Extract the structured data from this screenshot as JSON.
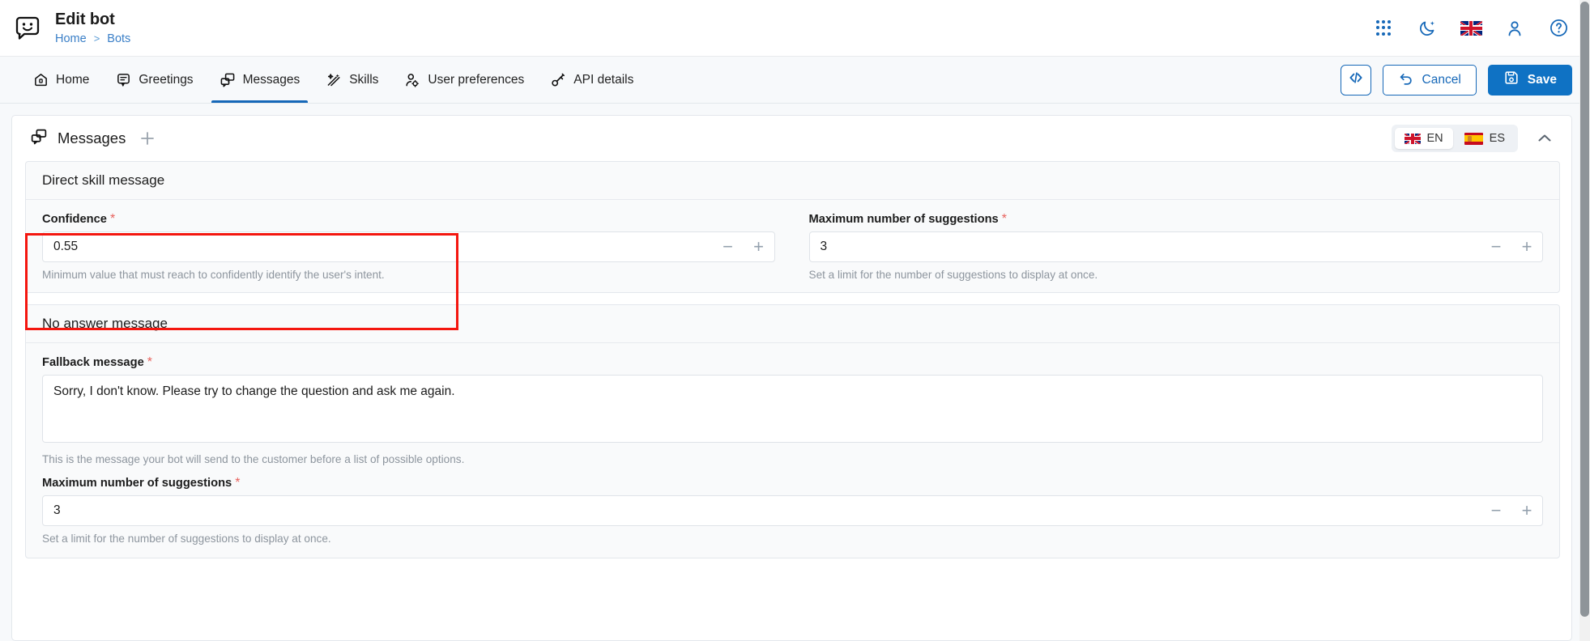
{
  "header": {
    "logo_icon": "chat-bot-smiley-icon",
    "title": "Edit bot",
    "breadcrumb": {
      "home": "Home",
      "separator": ">",
      "current": "Bots"
    },
    "icons": [
      {
        "name": "apps-grid-icon",
        "label": "Apps"
      },
      {
        "name": "dark-mode-moon-icon",
        "label": "Dark mode"
      },
      {
        "name": "language-flag-uk-icon",
        "label": "EN"
      },
      {
        "name": "user-account-icon",
        "label": "Account"
      },
      {
        "name": "help-question-icon",
        "label": "Help"
      }
    ]
  },
  "nav": {
    "tabs": [
      {
        "label": "Home",
        "icon": "home-icon",
        "active": false
      },
      {
        "label": "Greetings",
        "icon": "chat-bubble-icon",
        "active": false
      },
      {
        "label": "Messages",
        "icon": "messages-icon",
        "active": true
      },
      {
        "label": "Skills",
        "icon": "magic-wand-icon",
        "active": false
      },
      {
        "label": "User preferences",
        "icon": "user-settings-icon",
        "active": false
      },
      {
        "label": "API details",
        "icon": "api-key-icon",
        "active": false
      }
    ],
    "actions": {
      "code_button": {
        "label": "",
        "icon": "code-brackets-icon"
      },
      "cancel": {
        "label": "Cancel",
        "icon": "undo-arrow-icon"
      },
      "save": {
        "label": "Save",
        "icon": "floppy-disk-save-icon"
      }
    }
  },
  "card": {
    "title": "Messages",
    "title_icon": "messages-icon",
    "add_icon": "plus-icon",
    "collapse_icon": "chevron-up-icon",
    "languages": [
      {
        "code": "EN",
        "flag": "uk-flag-icon",
        "active": true
      },
      {
        "code": "ES",
        "flag": "spain-flag-icon",
        "active": false
      }
    ]
  },
  "panels": [
    {
      "id": "direct-skill-message",
      "title": "Direct skill message",
      "fields": [
        {
          "id": "confidence",
          "label": "Confidence",
          "required": true,
          "value": "0.55",
          "placeholder": "",
          "helper": "Minimum value that must reach to confidently identify the user's intent.",
          "stepper": {
            "minus": "−",
            "plus": "+"
          },
          "highlighted": true
        },
        {
          "id": "max-suggestions-direct",
          "label": "Maximum number of suggestions",
          "required": true,
          "value": "3",
          "placeholder": "",
          "helper": "Set a limit for the number of suggestions to display at once.",
          "stepper": {
            "minus": "−",
            "plus": "+"
          },
          "highlighted": false
        }
      ]
    },
    {
      "id": "no-answer-message",
      "title": "No answer message",
      "fields": [
        {
          "id": "fallback-message",
          "label": "Fallback message",
          "required": true,
          "value": "Sorry, I don't know. Please try to change the question and ask me again.",
          "placeholder": "",
          "helper": "This is the message your bot will send to the customer before a list of possible options.",
          "type": "textarea"
        },
        {
          "id": "max-suggestions-fallback",
          "label": "Maximum number of suggestions",
          "required": true,
          "value": "3",
          "placeholder": "",
          "helper": "Set a limit for the number of suggestions to display at once.",
          "stepper": {
            "minus": "−",
            "plus": "+"
          }
        }
      ]
    }
  ],
  "colors": {
    "accent": "#1668b8",
    "primary_button": "#0f72c4",
    "required_star": "#e8615c",
    "highlight_box": "#f4160f",
    "page_background": "#f7f9fb",
    "helper_text": "#8d959e"
  },
  "annotation": {
    "type": "highlight-rectangle",
    "target": "confidence-field"
  }
}
